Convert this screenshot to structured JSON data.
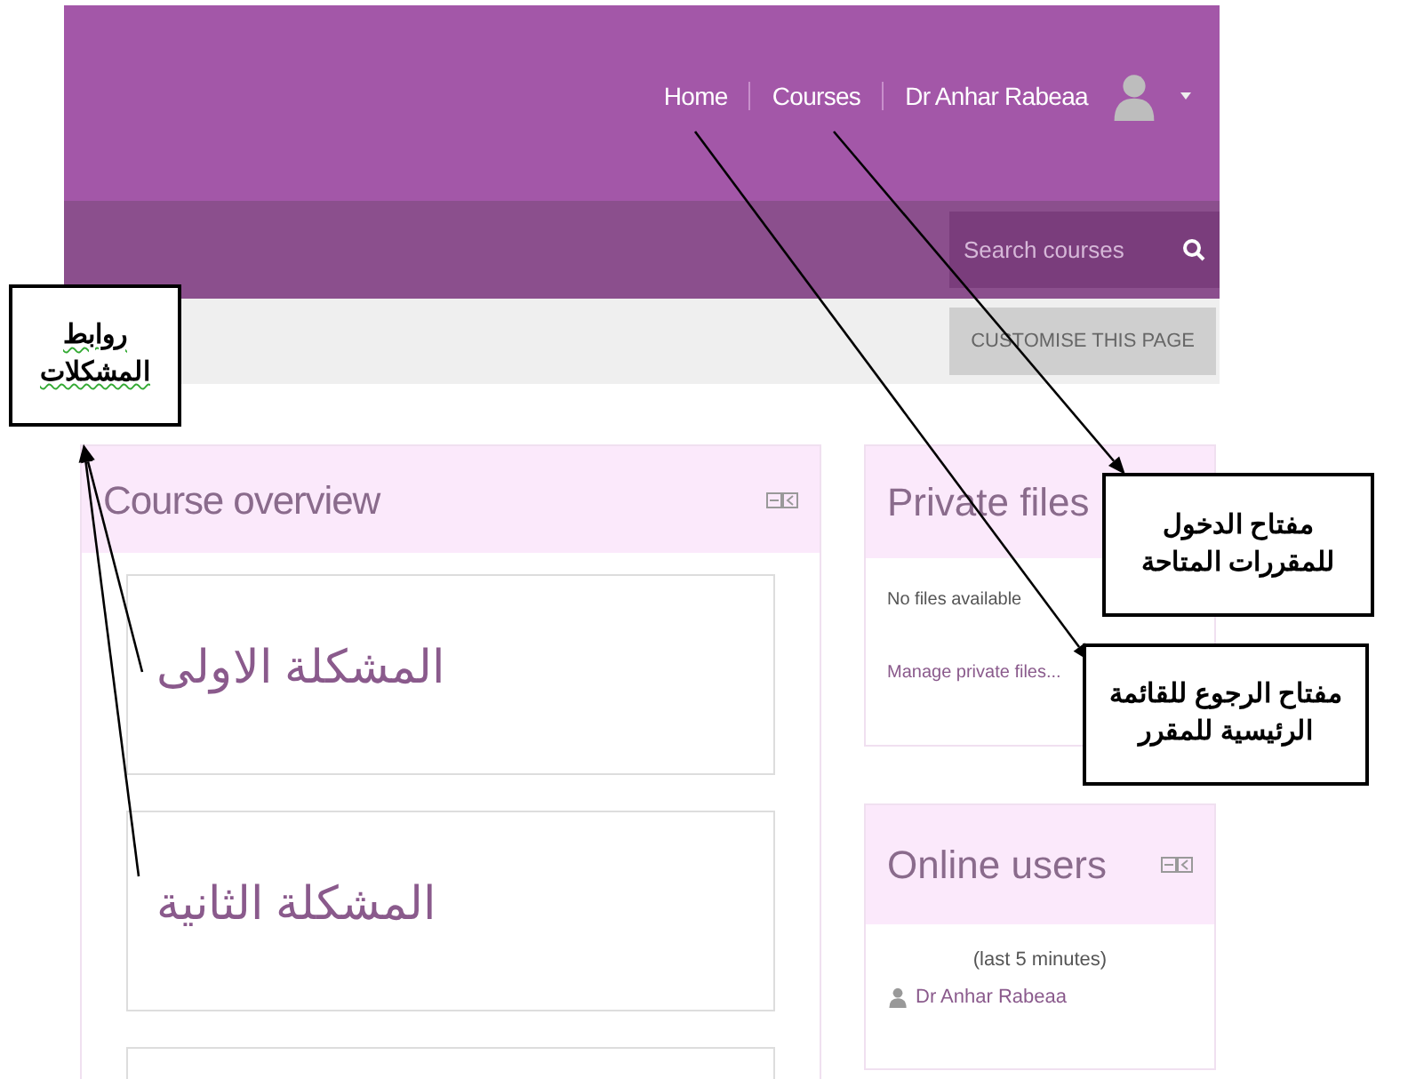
{
  "header": {
    "home_link": "Home",
    "courses_link": "Courses",
    "user_name": "Dr Anhar Rabeaa"
  },
  "search": {
    "placeholder": "Search courses"
  },
  "customise_button": "CUSTOMISE THIS PAGE",
  "course_overview": {
    "title": "Course overview",
    "courses": [
      {
        "name": "المشكلة الاولى"
      },
      {
        "name": "المشكلة الثانية"
      }
    ]
  },
  "private_files": {
    "title": "Private files",
    "empty_text": "No files available",
    "link": "Manage private files..."
  },
  "online_users": {
    "title": "Online users",
    "period": "(last 5 minutes)",
    "users": [
      {
        "name": "Dr Anhar Rabeaa"
      }
    ]
  },
  "annotations": [
    {
      "text": "روابط المشكلات",
      "underlined": true
    },
    {
      "text": "مفتاح الدخول للمقررات المتاحة",
      "underlined": false
    },
    {
      "text": "مفتاح الرجوع للقائمة الرئيسية للمقرر",
      "underlined": false
    }
  ]
}
